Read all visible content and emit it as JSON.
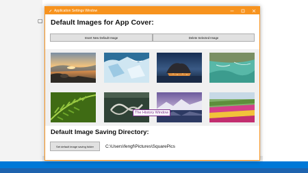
{
  "window": {
    "title": "Application Settings Window",
    "controls": [
      "minimize",
      "maximize",
      "close"
    ]
  },
  "cover_section": {
    "heading": "Default Images for App Cover:",
    "insert_button": "Insert New Default Image",
    "delete_button": "Delete Selected Image"
  },
  "thumbnails": [
    {
      "subject": "sunset-lake-rocks"
    },
    {
      "subject": "glacier-ice"
    },
    {
      "subject": "coastal-town-dusk"
    },
    {
      "subject": "turquoise-bay-aerial"
    },
    {
      "subject": "green-fern"
    },
    {
      "subject": "aerial-road"
    },
    {
      "subject": "snowy-mountain-lake"
    },
    {
      "subject": "flower-field"
    }
  ],
  "tooltip": "The History Window",
  "saving_section": {
    "heading": "Default Image Saving Directory:",
    "folder_button": "Set default image saving folder",
    "path": "C:\\Users\\fengf\\Pictures\\SquarePics"
  },
  "colors": {
    "accent": "#f7931e",
    "taskbar": "#0078d7",
    "tooltip": "#7a2b8b"
  }
}
